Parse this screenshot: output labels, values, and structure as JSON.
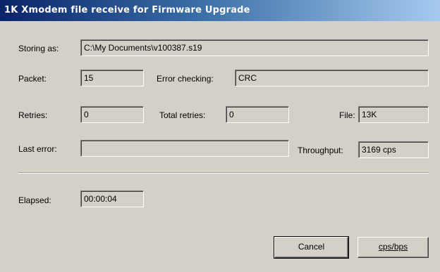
{
  "window": {
    "title": "1K Xmodem file receive for Firmware Upgrade"
  },
  "fields": {
    "storing_as": {
      "label": "Storing as:",
      "value": "C:\\My Documents\\v100387.s19"
    },
    "packet": {
      "label": "Packet:",
      "value": "15"
    },
    "error_checking": {
      "label": "Error checking:",
      "value": "CRC"
    },
    "retries": {
      "label": "Retries:",
      "value": "0"
    },
    "total_retries": {
      "label": "Total retries:",
      "value": "0"
    },
    "file": {
      "label": "File:",
      "value": "13K"
    },
    "last_error": {
      "label": "Last error:",
      "value": ""
    },
    "throughput": {
      "label": "Throughput:",
      "value": "3169 cps"
    },
    "elapsed": {
      "label": "Elapsed:",
      "value": "00:00:04"
    }
  },
  "buttons": {
    "cancel": "Cancel",
    "cps_bps": "cps/bps"
  }
}
